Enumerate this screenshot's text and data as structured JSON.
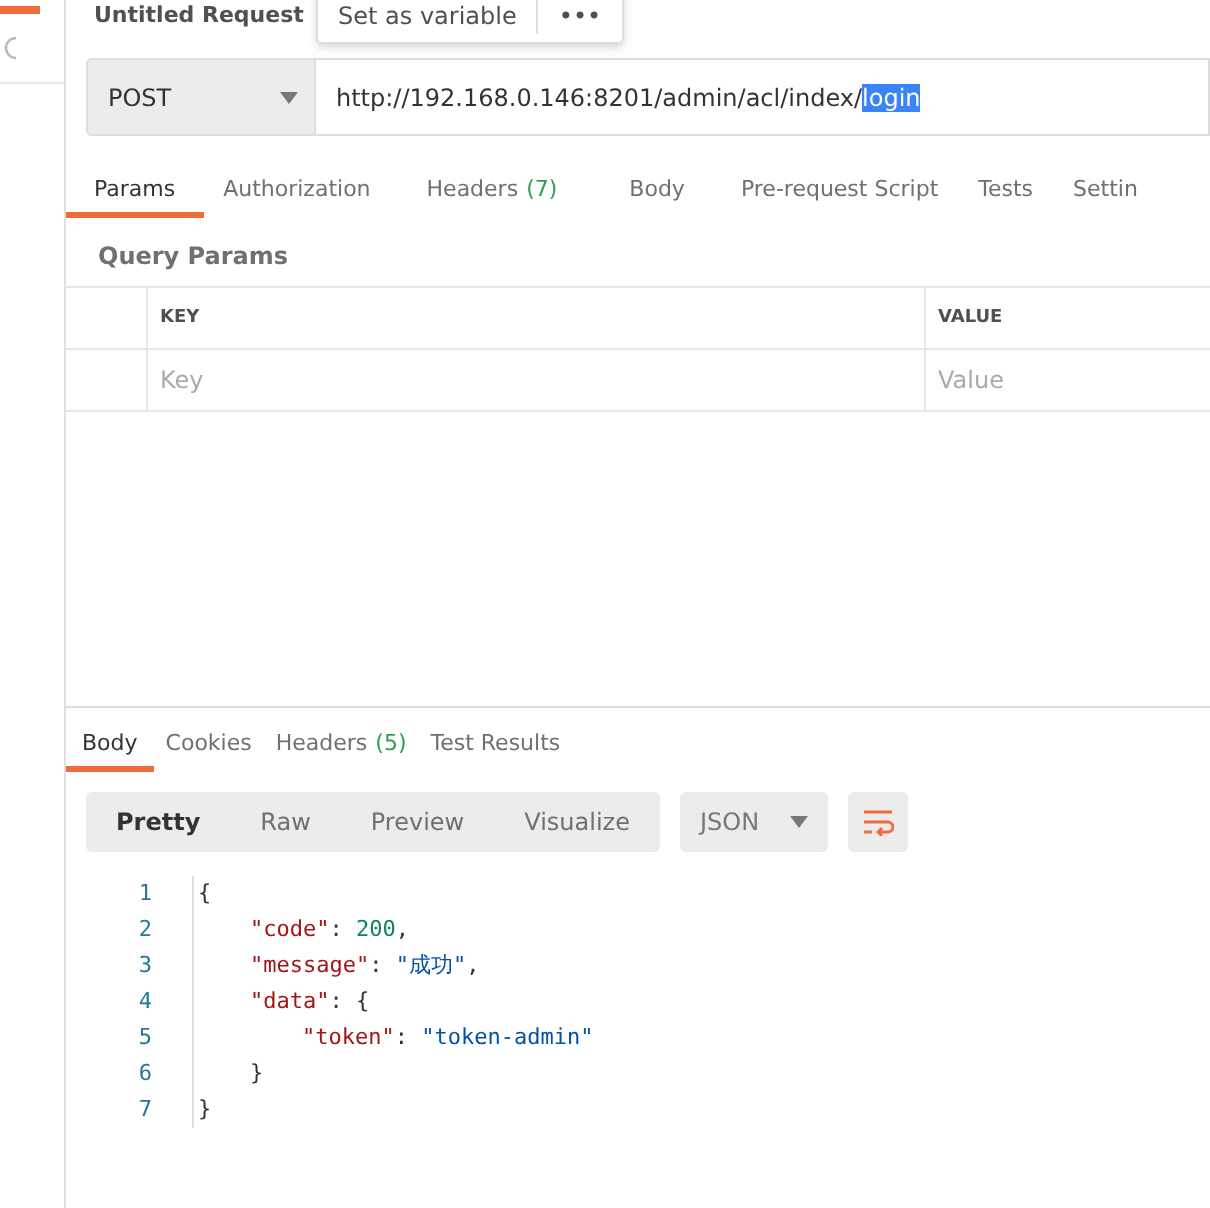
{
  "request": {
    "title": "Untitled Request",
    "popup": {
      "label": "Set as variable",
      "more": "•••"
    },
    "method": "POST",
    "url": "http://192.168.0.146:8201/admin/acl/index/",
    "url_selected": "login"
  },
  "request_tabs": [
    {
      "label": "Params",
      "selected": true
    },
    {
      "label": "Authorization",
      "selected": false
    },
    {
      "label": "Headers",
      "count": "(7)",
      "selected": false
    },
    {
      "label": "Body",
      "selected": false
    },
    {
      "label": "Pre-request Script",
      "selected": false
    },
    {
      "label": "Tests",
      "selected": false
    },
    {
      "label": "Settin",
      "selected": false
    }
  ],
  "query_params": {
    "title": "Query Params",
    "columns": [
      "KEY",
      "VALUE"
    ],
    "placeholders": [
      "Key",
      "Value"
    ]
  },
  "response_tabs": [
    {
      "label": "Body",
      "selected": true
    },
    {
      "label": "Cookies",
      "selected": false
    },
    {
      "label": "Headers",
      "count": "(5)",
      "selected": false
    },
    {
      "label": "Test Results",
      "selected": false
    }
  ],
  "view_modes": [
    {
      "label": "Pretty",
      "selected": true
    },
    {
      "label": "Raw",
      "selected": false
    },
    {
      "label": "Preview",
      "selected": false
    },
    {
      "label": "Visualize",
      "selected": false
    }
  ],
  "format": "JSON",
  "code": [
    {
      "tokens": [
        {
          "kind": "punct",
          "text": "{"
        }
      ],
      "children": [
        {
          "tokens": [
            {
              "kind": "key",
              "text": "\"code\""
            },
            {
              "kind": "punct",
              "text": ": "
            },
            {
              "kind": "number",
              "text": "200"
            },
            {
              "kind": "punct",
              "text": ","
            }
          ]
        },
        {
          "tokens": [
            {
              "kind": "key",
              "text": "\"message\""
            },
            {
              "kind": "punct",
              "text": ": "
            },
            {
              "kind": "string",
              "text": "\"成功\""
            },
            {
              "kind": "punct",
              "text": ","
            }
          ]
        },
        {
          "tokens": [
            {
              "kind": "key",
              "text": "\"data\""
            },
            {
              "kind": "punct",
              "text": ": {"
            }
          ],
          "children": [
            {
              "tokens": [
                {
                  "kind": "key",
                  "text": "\"token\""
                },
                {
                  "kind": "punct",
                  "text": ": "
                },
                {
                  "kind": "string",
                  "text": "\"token-admin\""
                }
              ]
            }
          ]
        },
        {
          "tokens": [
            {
              "kind": "punct",
              "text": "}"
            }
          ]
        }
      ]
    },
    {
      "tokens": [
        {
          "kind": "punct",
          "text": "}"
        }
      ]
    }
  ],
  "line_numbers": [
    "1",
    "2",
    "3",
    "4",
    "5",
    "6",
    "7"
  ]
}
